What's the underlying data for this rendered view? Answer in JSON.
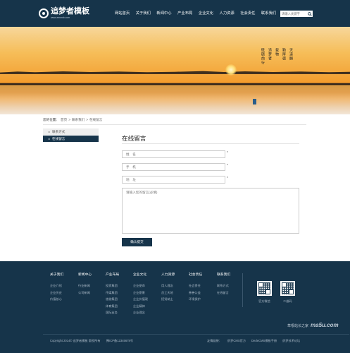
{
  "header": {
    "logo_name": "追梦者模板",
    "logo_url": "www.zmsmb.com",
    "nav": [
      "网站首页",
      "关于我们",
      "新闻中心",
      "产业布局",
      "企业文化",
      "人力资源",
      "社会责任",
      "联系我们"
    ],
    "search_placeholder": "请输入关键字"
  },
  "banner": {
    "poem": [
      "天道酬",
      "勤厚德",
      "载物",
      "追梦者",
      "砥砺前行"
    ]
  },
  "breadcrumb": {
    "label": "您的位置：",
    "items": [
      "首页",
      "联系我们",
      "在线留言"
    ],
    "separator": ">"
  },
  "sidebar": {
    "items": [
      {
        "label": "联系方式",
        "active": false
      },
      {
        "label": "在线留言",
        "active": true
      }
    ]
  },
  "form": {
    "title": "在线留言",
    "name_placeholder": "姓　名",
    "phone_placeholder": "手　机",
    "address_placeholder": "地　址",
    "required_mark": "*",
    "message_placeholder": "请输入您的留言(必填)",
    "submit_label": "确认提交"
  },
  "footer": {
    "columns": [
      {
        "title": "关于我们",
        "links": [
          "企业介绍",
          "企业历史",
          "价值核心"
        ]
      },
      {
        "title": "新闻中心",
        "links": [
          "行业新闻",
          "公司新闻"
        ]
      },
      {
        "title": "产业布局",
        "links": [
          "投资集团",
          "传媒集团",
          "旅游集团",
          "体育集团",
          "国际业务"
        ]
      },
      {
        "title": "企业文化",
        "links": [
          "企业使命",
          "企业愿景",
          "企业价值观",
          "企业精神",
          "企业理念"
        ]
      },
      {
        "title": "人力资源",
        "links": [
          "用人理念",
          "员工天地",
          "招贤纳士"
        ]
      },
      {
        "title": "社会责任",
        "links": [
          "社会责任",
          "慈善公益",
          "环境保护"
        ]
      },
      {
        "title": "联系我们",
        "links": [
          "联系方式",
          "在线留言"
        ]
      }
    ],
    "qr": [
      {
        "label": "官方微信"
      },
      {
        "label": "二维码"
      }
    ],
    "copyright": "Copyright 2014© 追梦者模板 版权所有　　豫ICP备12345678号",
    "friend_label": "友情链接：",
    "friends": [
      "织梦CMS官方",
      "DedeCMS模板手册",
      "织梦技术论坛"
    ],
    "watermark_cn": "草根站长之家",
    "watermark_en": "ma5u.com"
  }
}
